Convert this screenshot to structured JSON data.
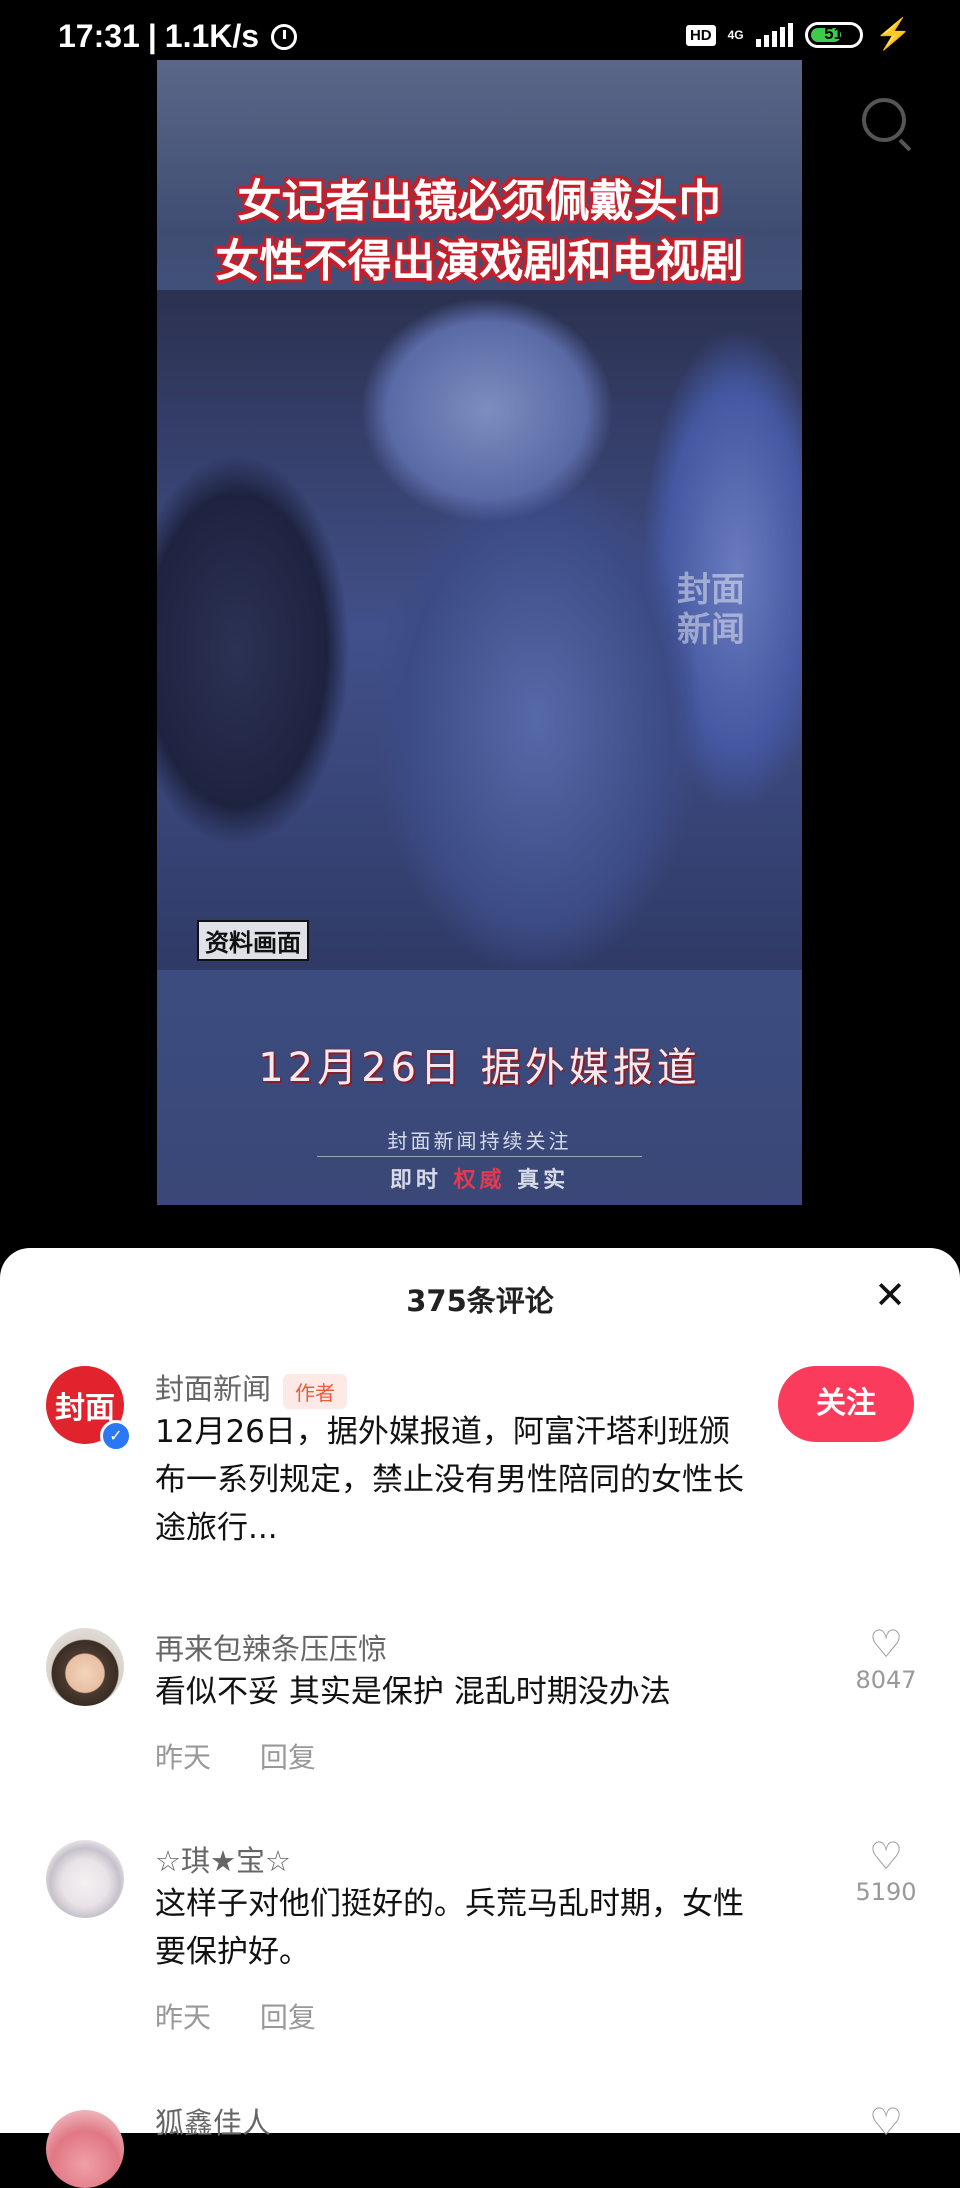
{
  "status_bar": {
    "time": "17:31",
    "net_speed": "1.1K/s",
    "hd": "HD",
    "network": "4G",
    "battery": "51"
  },
  "video": {
    "headline": [
      "女记者出镜必须佩戴头巾",
      "女性不得出演戏剧和电视剧"
    ],
    "watermark": "封面新闻",
    "archive_tag": "资料画面",
    "date_caption": "12月26日 据外媒报道",
    "footer_line1": "封面新闻持续关注",
    "footer_line2": {
      "part1": "即时 ",
      "accent": "权威",
      "part2": " 真实"
    }
  },
  "comments_panel": {
    "title": "375条评论",
    "items": [
      {
        "username": "封面新闻",
        "avatar_text": "封面",
        "badge": "作者",
        "follow_label": "关注",
        "text": "12月26日，据外媒报道，阿富汗塔利班颁布一系列规定，禁止没有男性陪同的女性长途旅行..."
      },
      {
        "username": "再来包辣条压压惊",
        "text": "看似不妥 其实是保护 混乱时期没办法",
        "time": "昨天",
        "reply_label": "回复",
        "likes": "8047"
      },
      {
        "username": "☆琪★宝☆",
        "text": "这样子对他们挺好的。兵荒马乱时期，女性要保护好。",
        "time": "昨天",
        "reply_label": "回复",
        "likes": "5190"
      },
      {
        "username": "狐鑫佳人"
      }
    ]
  }
}
